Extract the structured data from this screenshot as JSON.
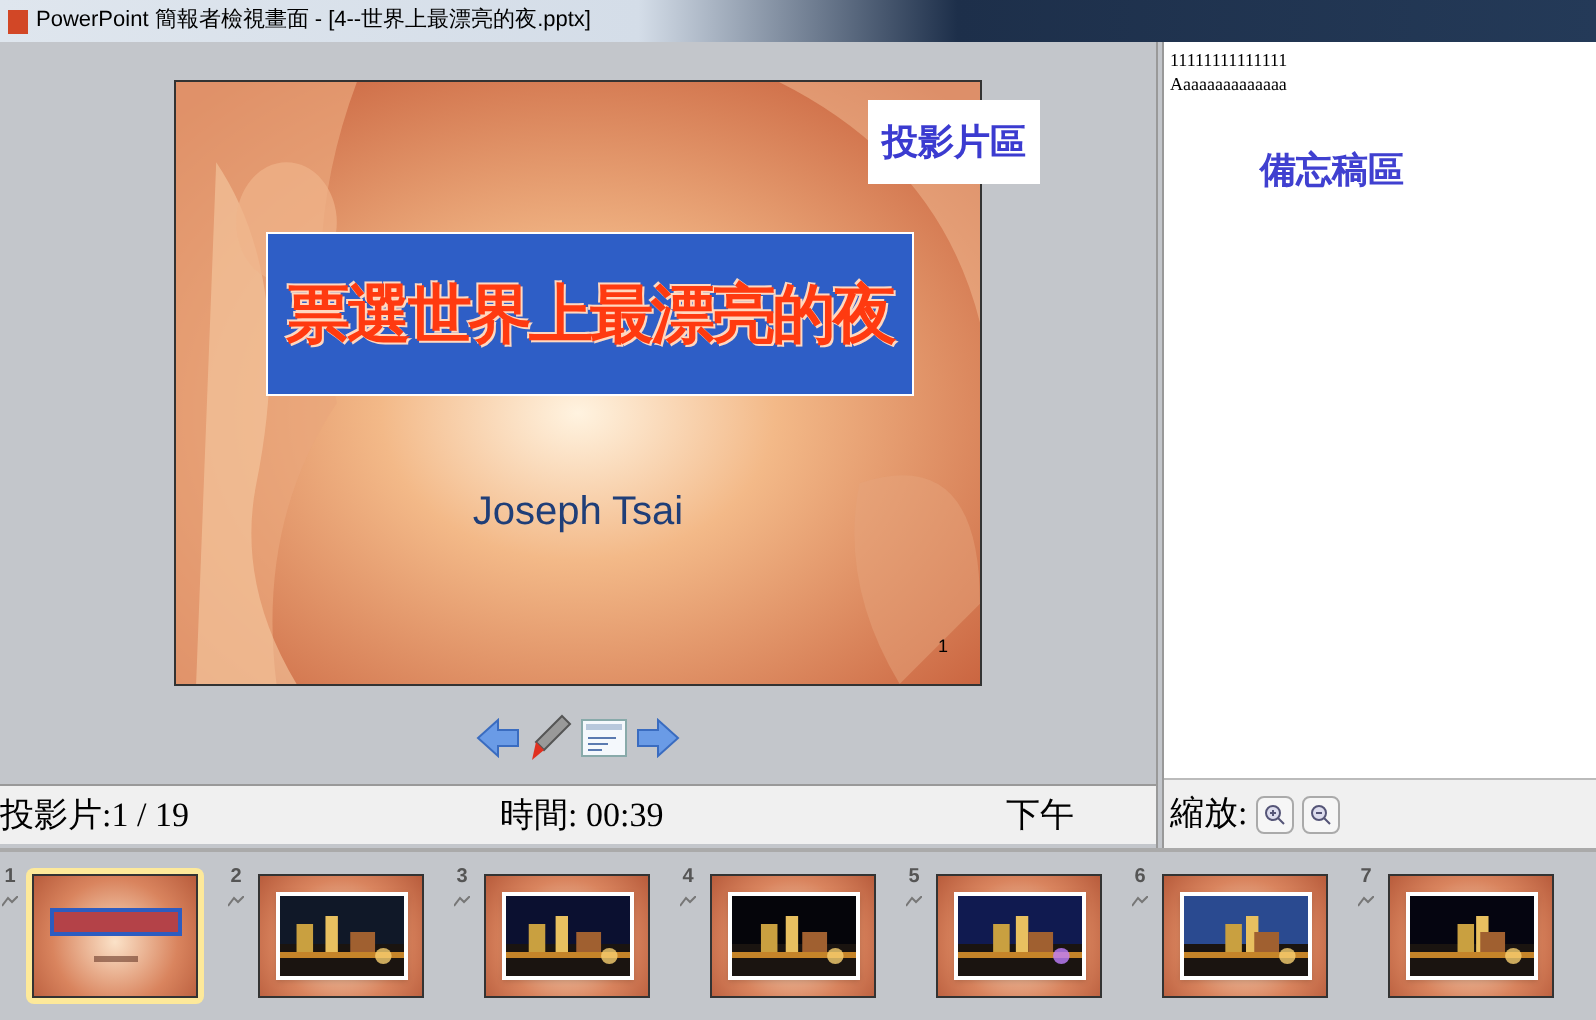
{
  "window": {
    "title": "PowerPoint 簡報者檢視畫面 - [4--世界上最漂亮的夜.pptx]"
  },
  "slide": {
    "area_label": "投影片區",
    "title": "票選世界上最漂亮的夜",
    "subtitle": "Joseph Tsai",
    "number": "1"
  },
  "notes": {
    "lines": [
      "11111111111111",
      "Aaaaaaaaaaaaaa"
    ],
    "area_label": "備忘稿區"
  },
  "status": {
    "slide": "投影片:1 / 19",
    "time": "時間: 00:39",
    "clock": "下午",
    "zoom_label": "縮放:"
  },
  "thumbnails": [
    {
      "number": "1",
      "kind": "title",
      "selected": true
    },
    {
      "number": "2",
      "selected": false
    },
    {
      "number": "3",
      "selected": false
    },
    {
      "number": "4",
      "selected": false
    },
    {
      "number": "5",
      "selected": false
    },
    {
      "number": "6",
      "selected": false
    },
    {
      "number": "7",
      "selected": false
    }
  ]
}
